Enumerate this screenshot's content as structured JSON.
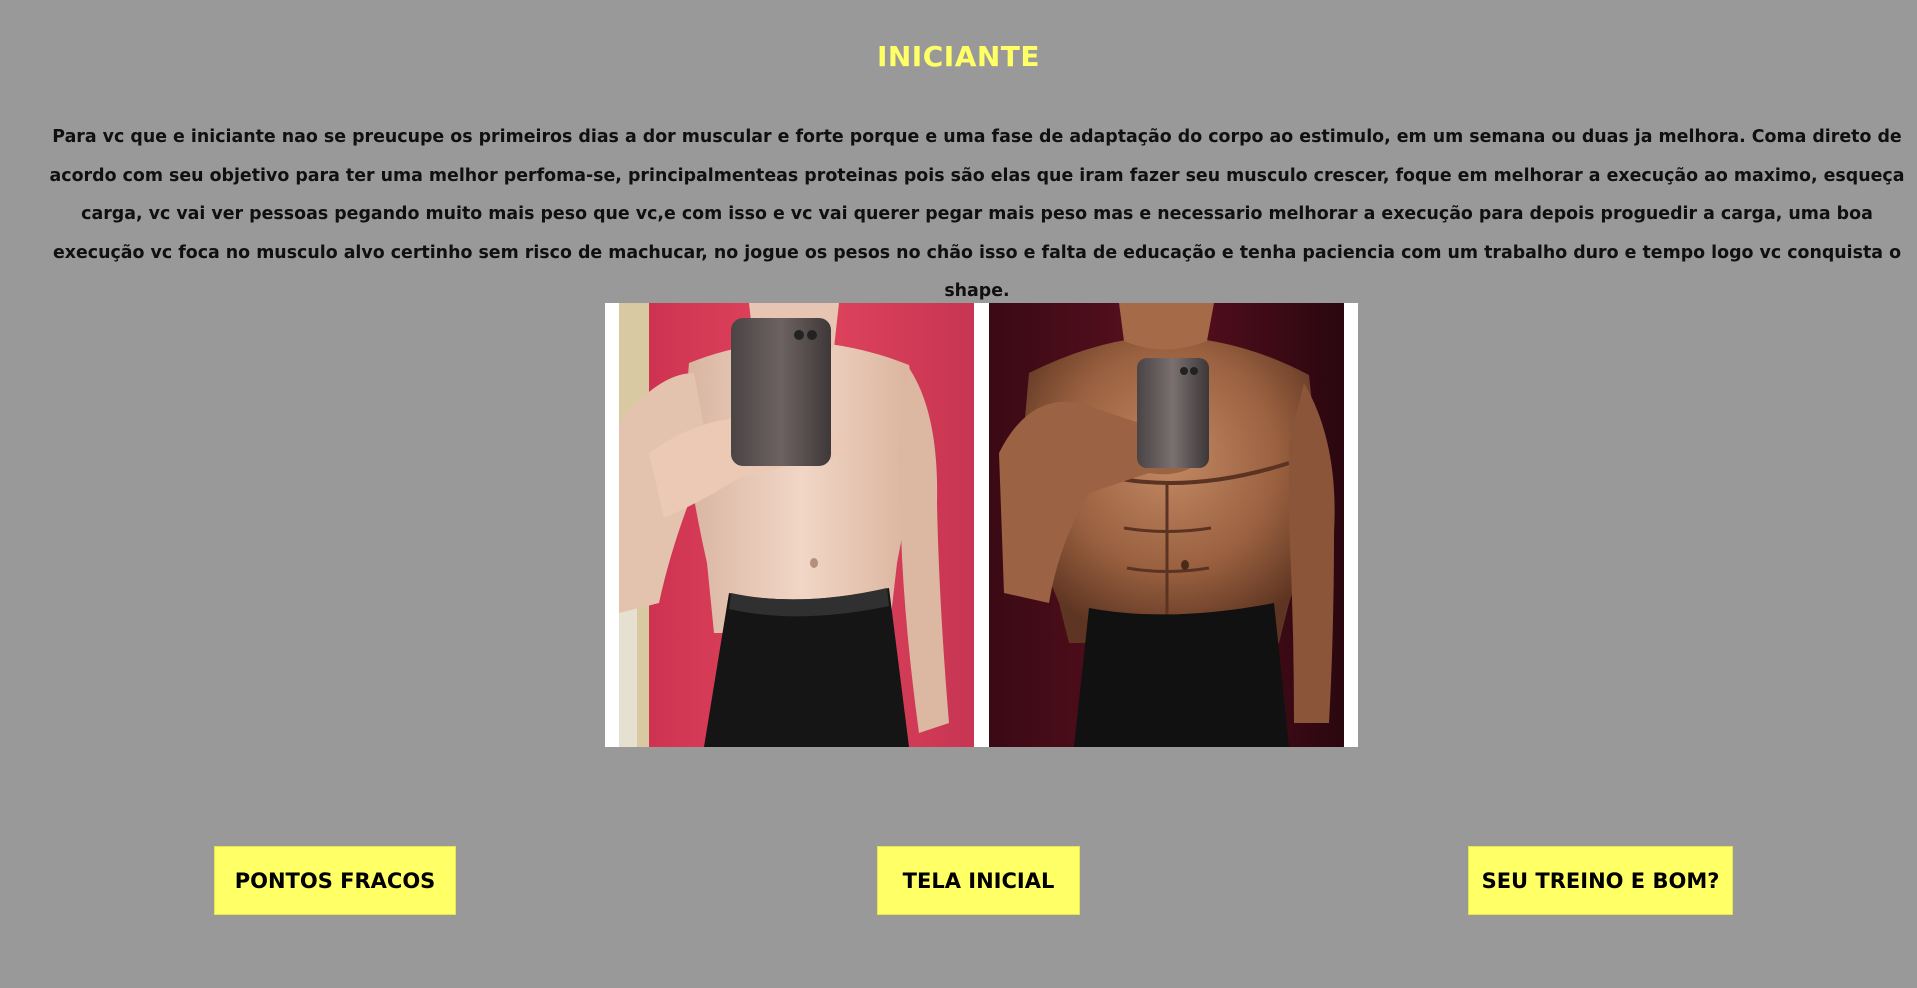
{
  "page": {
    "title": "INICIANTE",
    "paragraph": "Para vc que e iniciante nao se preucupe os primeiros dias a dor muscular e forte porque e uma fase de adaptação do corpo ao estimulo, em um semana ou duas ja melhora. Coma direto de acordo com seu objetivo para ter uma melhor perfoma-se, principalmenteas proteinas pois são elas que iram fazer seu musculo crescer, foque em melhorar a execução ao maximo, esqueça carga, vc vai ver pessoas pegando muito mais peso que vc,e com isso e vc vai querer pegar mais peso mas e necessario melhorar a execução para depois proguedir a carga, uma boa execução vc foca no musculo alvo certinho sem risco de machucar, no jogue os pesos no chão isso e falta de educação e tenha paciencia com um trabalho duro e tempo logo vc conquista o shape."
  },
  "buttons": {
    "weak_points": "PONTOS FRACOS",
    "home": "TELA INICIAL",
    "your_training": "SEU TREINO E BOM?"
  },
  "colors": {
    "background": "#999999",
    "accent": "#ffff66",
    "text": "#101010"
  }
}
